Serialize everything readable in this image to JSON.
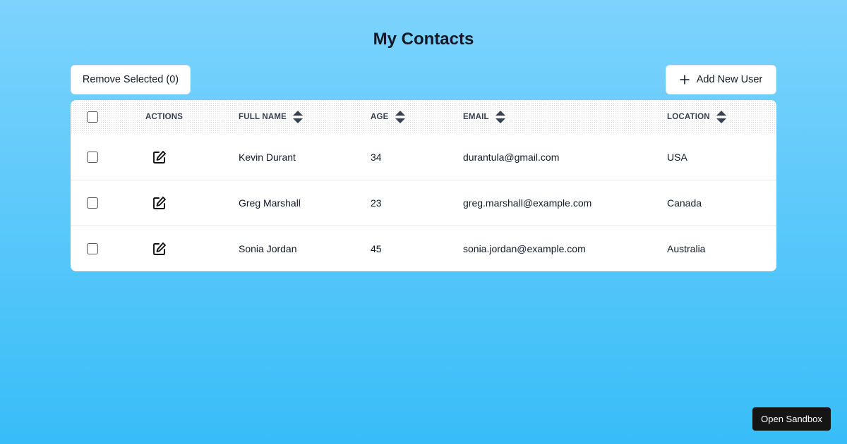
{
  "page": {
    "title": "My Contacts"
  },
  "toolbar": {
    "remove_label": "Remove Selected (0)",
    "add_label": "Add New User",
    "add_icon": "plus-icon"
  },
  "table": {
    "columns": [
      "ACTIONS",
      "FULL NAME",
      "AGE",
      "EMAIL",
      "LOCATION"
    ],
    "rows": [
      {
        "name": "Kevin Durant",
        "age": "34",
        "email": "durantula@gmail.com",
        "location": "USA"
      },
      {
        "name": "Greg Marshall",
        "age": "23",
        "email": "greg.marshall@example.com",
        "location": "Canada"
      },
      {
        "name": "Sonia Jordan",
        "age": "45",
        "email": "sonia.jordan@example.com",
        "location": "Australia"
      }
    ]
  },
  "footer": {
    "sandbox_label": "Open Sandbox"
  },
  "colors": {
    "background_top": "#7dd3fc",
    "background_bottom": "#38bdf8",
    "card": "#ffffff",
    "text": "#111827"
  }
}
